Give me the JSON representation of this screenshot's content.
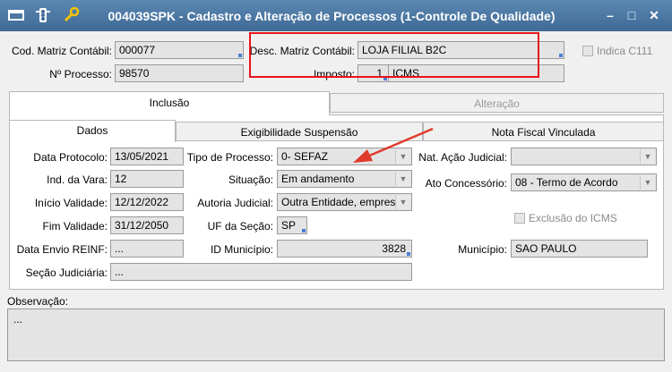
{
  "window": {
    "title": "004039SPK - Cadastro e Alteração de Processos (1-Controle De Qualidade)",
    "minimize": "–",
    "maximize": "□",
    "close": "✕"
  },
  "header": {
    "cod_matriz_label": "Cod. Matriz Contábil:",
    "cod_matriz_value": "000077",
    "desc_matriz_label": "Desc. Matriz Contábil:",
    "desc_matriz_value": "LOJA FILIAL B2C",
    "indica_label": "Indica C111",
    "processo_label": "Nº Processo:",
    "processo_value": "98570",
    "imposto_label": "Imposto:",
    "imposto_code": "1",
    "imposto_name": "ICMS"
  },
  "main_tabs": [
    "Inclusão",
    "Alteração"
  ],
  "sub_tabs": [
    "Dados",
    "Exigibilidade Suspensão",
    "Nota Fiscal Vinculada"
  ],
  "form": {
    "data_protocolo_label": "Data Protocolo:",
    "data_protocolo": "13/05/2021",
    "ind_vara_label": "Ind. da Vara:",
    "ind_vara": "12",
    "inicio_validade_label": "Início Validade:",
    "inicio_validade": "12/12/2022",
    "fim_validade_label": "Fim Validade:",
    "fim_validade": "31/12/2050",
    "data_envio_label": "Data Envio REINF:",
    "data_envio": "...",
    "secao_judiciaria_label": "Seção Judiciária:",
    "secao_judiciaria": "...",
    "tipo_processo_label": "Tipo de Processo:",
    "tipo_processo": "0- SEFAZ",
    "situacao_label": "Situação:",
    "situacao": "Em andamento",
    "autoria_label": "Autoria Judicial:",
    "autoria": "Outra Entidade, empres",
    "uf_label": "UF da Seção:",
    "uf": "SP",
    "id_municipio_label": "ID Município:",
    "id_municipio": "3828",
    "nat_acao_label": "Nat. Ação Judicial:",
    "nat_acao": "",
    "ato_label": "Ato Concessório:",
    "ato": "08 - Termo de Acordo",
    "exclusao_label": "Exclusão do ICMS",
    "municipio_label": "Município:",
    "municipio": "SAO PAULO"
  },
  "observacao": {
    "label": "Observação:",
    "value": "..."
  },
  "colors": {
    "titlebar": "#4a76a3",
    "highlight_box": "#e8141b",
    "annotation_arrow": "#e03a2c"
  }
}
